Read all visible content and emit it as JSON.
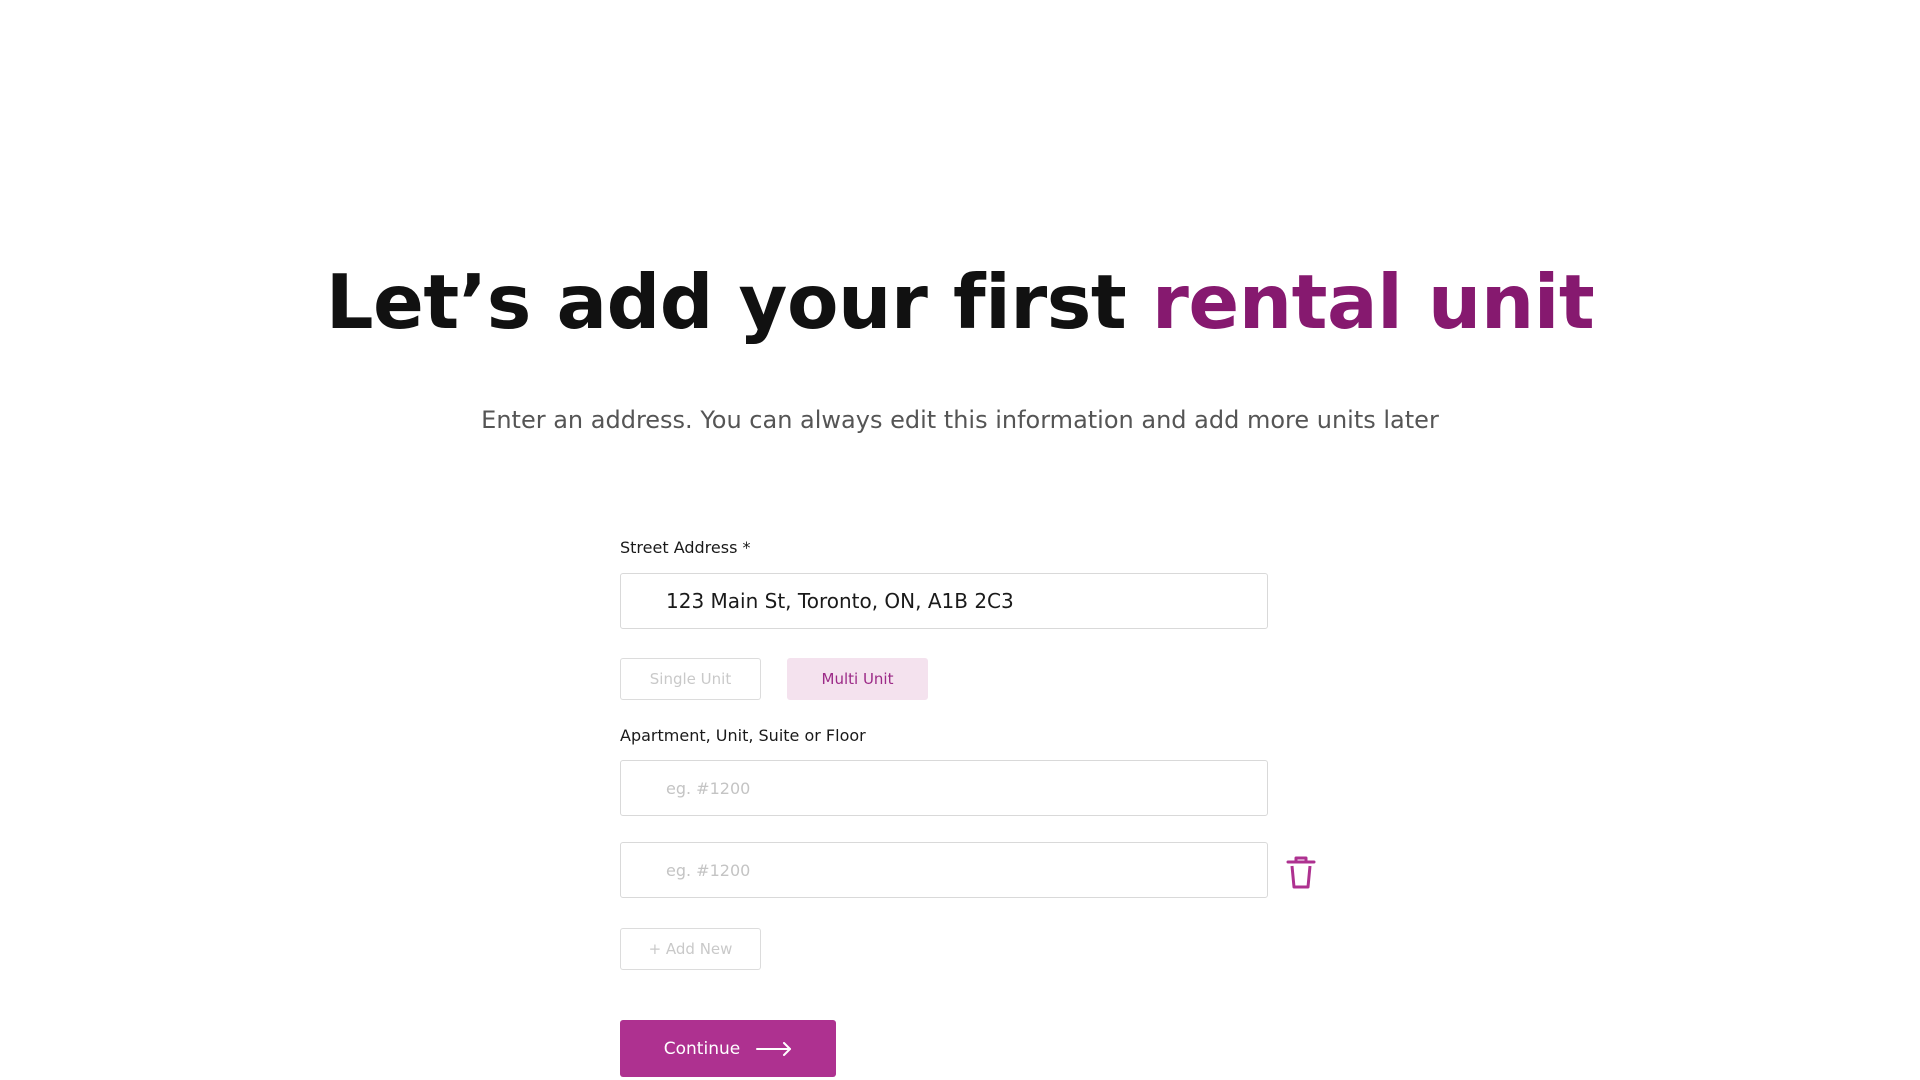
{
  "heading": {
    "prefix": "Let’s add your first ",
    "accent": "rental unit"
  },
  "subheading": "Enter an address. You can always edit this information and add more units later",
  "street_address": {
    "label": "Street Address *",
    "value": "123 Main St, Toronto, ON, A1B 2C3"
  },
  "unit_type": {
    "options": [
      {
        "label": "Single Unit",
        "selected": false
      },
      {
        "label": "Multi Unit",
        "selected": true
      }
    ]
  },
  "units": {
    "label": "Apartment, Unit, Suite or Floor",
    "fields": [
      {
        "value": "",
        "placeholder": "eg. #1200"
      },
      {
        "value": "",
        "placeholder": "eg. #1200"
      }
    ],
    "add_new_label": "+ Add New",
    "delete_icon": "trash-icon"
  },
  "continue_button": {
    "label": "Continue",
    "icon": "arrow-right-icon"
  },
  "colors": {
    "accent": "#86196f",
    "button": "#ae3190",
    "selected_toggle_bg": "#f4e2ee",
    "selected_toggle_text": "#9c2a87"
  }
}
